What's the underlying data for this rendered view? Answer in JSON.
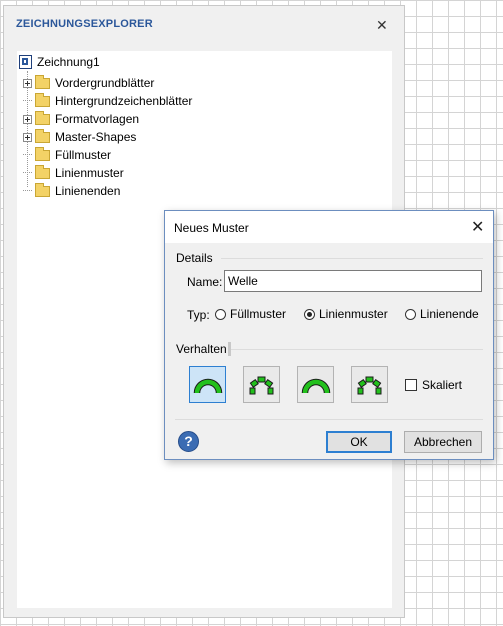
{
  "explorer": {
    "title": "ZEICHNUNGSEXPLORER",
    "close_icon": "close-icon",
    "root": {
      "label": "Zeichnung1",
      "icon": "drawing-document-icon"
    },
    "items": [
      {
        "label": "Vordergrundblätter",
        "expandable": true
      },
      {
        "label": "Hintergrundzeichenblätter",
        "expandable": false
      },
      {
        "label": "Formatvorlagen",
        "expandable": true
      },
      {
        "label": "Master-Shapes",
        "expandable": true
      },
      {
        "label": "Füllmuster",
        "expandable": false
      },
      {
        "label": "Linienmuster",
        "expandable": false
      },
      {
        "label": "Linienenden",
        "expandable": false
      }
    ]
  },
  "dialog": {
    "title": "Neues Muster",
    "close_icon": "close-icon",
    "details_label": "Details",
    "name_label": "Name:",
    "name_value": "Welle",
    "type_label": "Typ:",
    "type_options": [
      {
        "label": "Füllmuster",
        "checked": false
      },
      {
        "label": "Linienmuster",
        "checked": true
      },
      {
        "label": "Linienende",
        "checked": false
      }
    ],
    "behavior_label": "Verhalten",
    "behavior_options": [
      {
        "icon": "stretch-curve-icon",
        "selected": true
      },
      {
        "icon": "segmented-curve-icon",
        "selected": false
      },
      {
        "icon": "curve-icon",
        "selected": false
      },
      {
        "icon": "segmented-curve-alt-icon",
        "selected": false
      }
    ],
    "scaled_label": "Skaliert",
    "scaled_checked": false,
    "help_icon": "help-icon",
    "ok_label": "OK",
    "cancel_label": "Abbrechen"
  },
  "colors": {
    "accent": "#2b579a",
    "selection": "#cde4f7",
    "icon_green": "#22c01c",
    "folder": "#f3d266"
  }
}
